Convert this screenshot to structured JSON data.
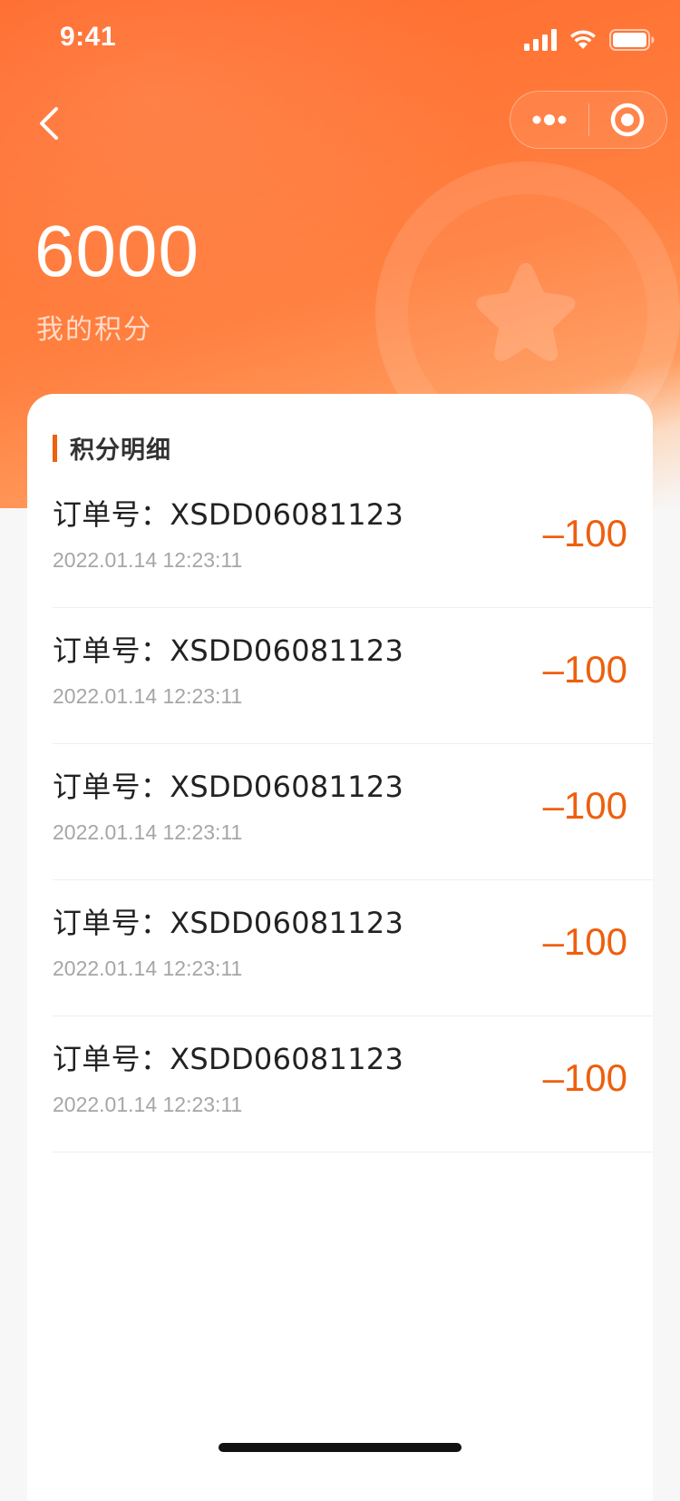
{
  "status_bar": {
    "time": "9:41"
  },
  "nav": {
    "back_icon": "chevron-left-icon",
    "more_icon": "more-dots-icon",
    "close_icon": "target-circle-icon"
  },
  "points": {
    "value": "6000",
    "label": "我的积分"
  },
  "details": {
    "title": "积分明细",
    "records": [
      {
        "order": "订单号：XSDD06081123",
        "time": "2022.01.14 12:23:11",
        "amount": "–100"
      },
      {
        "order": "订单号：XSDD06081123",
        "time": "2022.01.14 12:23:11",
        "amount": "–100"
      },
      {
        "order": "订单号：XSDD06081123",
        "time": "2022.01.14 12:23:11",
        "amount": "–100"
      },
      {
        "order": "订单号：XSDD06081123",
        "time": "2022.01.14 12:23:11",
        "amount": "–100"
      },
      {
        "order": "订单号：XSDD06081123",
        "time": "2022.01.14 12:23:11",
        "amount": "–100"
      }
    ]
  },
  "colors": {
    "accent": "#ff6a2b",
    "amount": "#ee5f0d"
  }
}
